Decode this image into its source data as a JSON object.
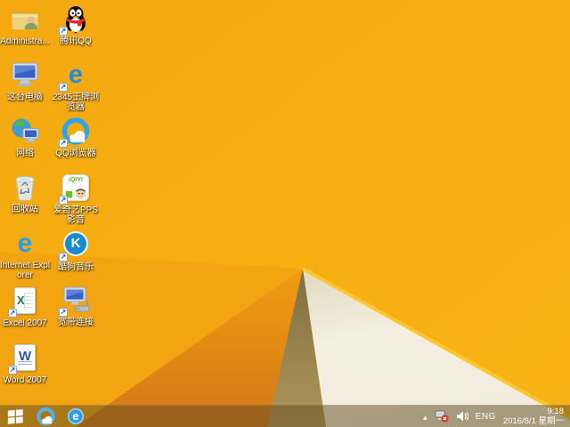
{
  "desktop": {
    "icons": [
      {
        "id": "administrator-folder",
        "label": "Administra..."
      },
      {
        "id": "tencent-qq",
        "label": "腾讯QQ"
      },
      {
        "id": "this-pc",
        "label": "这台电脑"
      },
      {
        "id": "2345-browser",
        "label": "2345王牌浏览器"
      },
      {
        "id": "network",
        "label": "网络"
      },
      {
        "id": "qq-browser",
        "label": "QQ浏览器"
      },
      {
        "id": "recycle-bin",
        "label": "回收站"
      },
      {
        "id": "iqiyi-pps",
        "label": "爱奇艺PPS 影音"
      },
      {
        "id": "internet-explorer",
        "label": "Internet Explorer"
      },
      {
        "id": "kugou-music",
        "label": "酷狗音乐"
      },
      {
        "id": "excel-2007",
        "label": "Excel 2007"
      },
      {
        "id": "broadband-connection",
        "label": "宽带连接"
      },
      {
        "id": "word-2007",
        "label": "Word 2007"
      }
    ]
  },
  "glyphs": {
    "ie_e": "e",
    "browser2345_e": "e",
    "taskbar_ie_e": "e",
    "kugou_k": "K",
    "excel_x": "X",
    "word_w": "W",
    "iqiyi_logo": "iQIYI"
  },
  "taskbar": {
    "tray": {
      "language": "ENG",
      "time": "9:18",
      "date": "2016/8/1 星期一"
    }
  },
  "colors": {
    "wallpaper_orange": "#F6AF12",
    "wallpaper_white": "#F2EDDD",
    "wallpaper_olive": "#A08A4E",
    "highlight_edge": "#FFC72F",
    "taskbar_tint": "rgba(94,74,30,0.5)"
  }
}
